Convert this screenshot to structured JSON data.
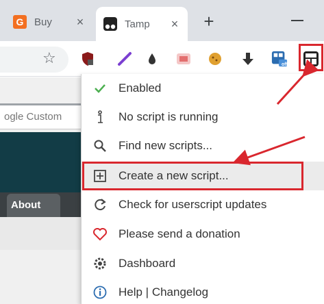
{
  "tabs": [
    {
      "title": "Buy",
      "favicon": "g-logo-icon",
      "close": "×"
    },
    {
      "title": "Tamp",
      "favicon": "tampermonkey-icon",
      "close": "×"
    }
  ],
  "new_tab_label": "+",
  "toolbar": {
    "extensions": [
      "shield-extension-icon",
      "feather-extension-icon",
      "drop-extension-icon",
      "translate-extension-icon",
      "cookie-extension-icon",
      "download-extension-icon",
      "grid-extension-icon",
      "tampermonkey-icon"
    ],
    "ext_badge": "off"
  },
  "page": {
    "search_text": "ogle Custom",
    "about_tab": "About"
  },
  "menu": {
    "items": [
      {
        "label": "Enabled",
        "icon": "checkmark-icon"
      },
      {
        "label": "No script is running",
        "icon": "info-icon"
      },
      {
        "label": "Find new scripts...",
        "icon": "search-icon"
      },
      {
        "label": "Create a new script...",
        "icon": "add-script-icon"
      },
      {
        "label": "Check for userscript updates",
        "icon": "refresh-icon"
      },
      {
        "label": "Please send a donation",
        "icon": "heart-icon"
      },
      {
        "label": "Dashboard",
        "icon": "gear-icon"
      },
      {
        "label": "Help | Changelog",
        "icon": "info-circle-icon"
      }
    ]
  },
  "colors": {
    "annotation_red": "#d9272e",
    "check_green": "#4caf50",
    "tab_strip": "#dee1e6"
  }
}
